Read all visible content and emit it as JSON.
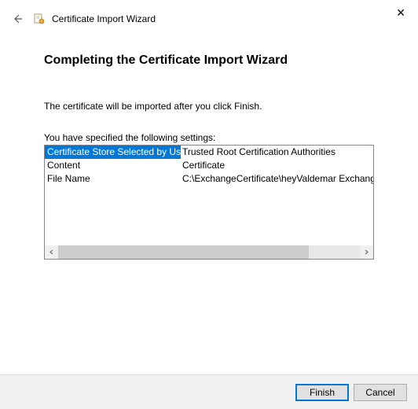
{
  "header": {
    "title": "Certificate Import Wizard"
  },
  "heading": "Completing the Certificate Import Wizard",
  "description": "The certificate will be imported after you click Finish.",
  "settings_label": "You have specified the following settings:",
  "settings": [
    {
      "label": "Certificate Store Selected by User",
      "value": "Trusted Root Certification Authorities"
    },
    {
      "label": "Content",
      "value": "Certificate"
    },
    {
      "label": "File Name",
      "value": "C:\\ExchangeCertificate\\heyValdemar Exchange Certi"
    }
  ],
  "buttons": {
    "finish": "Finish",
    "cancel": "Cancel"
  }
}
